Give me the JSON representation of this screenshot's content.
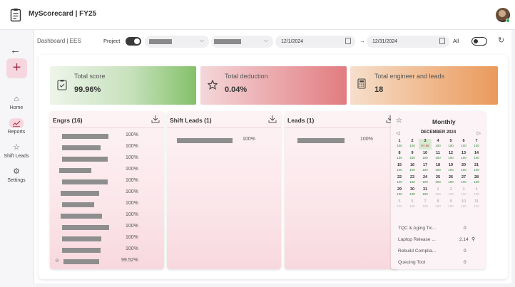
{
  "app": {
    "title": "MyScorecard | FY25"
  },
  "sidebar": {
    "new_label": "+",
    "items": [
      {
        "label": "Home",
        "icon": "home-icon"
      },
      {
        "label": "Reports",
        "icon": "reports-icon",
        "active": true
      },
      {
        "label": "Shift Leads",
        "icon": "star-icon"
      },
      {
        "label": "Settings",
        "icon": "gear-icon"
      }
    ]
  },
  "filters": {
    "breadcrumb": "Dashboard | EES",
    "project_label": "Project",
    "start_date": "12/1/2024",
    "end_date": "12/31/2024",
    "arrow": "→",
    "all_label": "All"
  },
  "stats": [
    {
      "title": "Total score",
      "value": "99.96%",
      "icon": "clipboard-check-icon"
    },
    {
      "title": "Total deduction",
      "value": "0.04%",
      "icon": "star-icon"
    },
    {
      "title": "Total engineer and leads",
      "value": "18",
      "icon": "calculator-icon"
    }
  ],
  "panels": {
    "engrs": {
      "title": "Engrs (16)",
      "rows": [
        "100%",
        "100%",
        "100%",
        "100%",
        "100%",
        "100%",
        "100%",
        "100%",
        "100%",
        "100%",
        "100%",
        "99.52%"
      ]
    },
    "shift_leads": {
      "title": "Shift Leads (1)",
      "rows": [
        "100%"
      ]
    },
    "leads": {
      "title": "Leads (1)",
      "rows": [
        "100%"
      ]
    }
  },
  "monthly": {
    "title": "Monthly",
    "month": "DECEMBER 2024",
    "weeks": [
      [
        [
          "1",
          "100"
        ],
        [
          "2",
          "100"
        ],
        [
          "3",
          "97.56"
        ],
        [
          "4",
          "100"
        ],
        [
          "5",
          "100"
        ],
        [
          "6",
          "100"
        ],
        [
          "7",
          "100"
        ]
      ],
      [
        [
          "8",
          "100"
        ],
        [
          "9",
          "100"
        ],
        [
          "10",
          "100"
        ],
        [
          "11",
          "100"
        ],
        [
          "12",
          "100"
        ],
        [
          "13",
          "100"
        ],
        [
          "14",
          "100"
        ]
      ],
      [
        [
          "15",
          "100"
        ],
        [
          "16",
          "100"
        ],
        [
          "17",
          "100"
        ],
        [
          "18",
          "100"
        ],
        [
          "19",
          "100"
        ],
        [
          "20",
          "100"
        ],
        [
          "21",
          "100"
        ]
      ],
      [
        [
          "22",
          "100"
        ],
        [
          "23",
          "100"
        ],
        [
          "24",
          "100"
        ],
        [
          "25",
          "100"
        ],
        [
          "26",
          "100"
        ],
        [
          "27",
          "100"
        ],
        [
          "28",
          "100"
        ]
      ],
      [
        [
          "29",
          "100"
        ],
        [
          "30",
          "100"
        ],
        [
          "31",
          "100"
        ],
        [
          "1",
          "100"
        ],
        [
          "2",
          "100"
        ],
        [
          "3",
          "100"
        ],
        [
          "4",
          "100"
        ]
      ],
      [
        [
          "5",
          "100"
        ],
        [
          "6",
          "100"
        ],
        [
          "7",
          "100"
        ],
        [
          "8",
          "100"
        ],
        [
          "9",
          "100"
        ],
        [
          "10",
          "100"
        ],
        [
          "11",
          "100"
        ]
      ]
    ],
    "tools": [
      {
        "name": "TQC & Aging Tic...",
        "value": "0"
      },
      {
        "name": "Laptop Release ...",
        "value": "2.14"
      },
      {
        "name": "Rebuild Complia...",
        "value": "0"
      },
      {
        "name": "Queuing Tool",
        "value": "0"
      }
    ]
  }
}
